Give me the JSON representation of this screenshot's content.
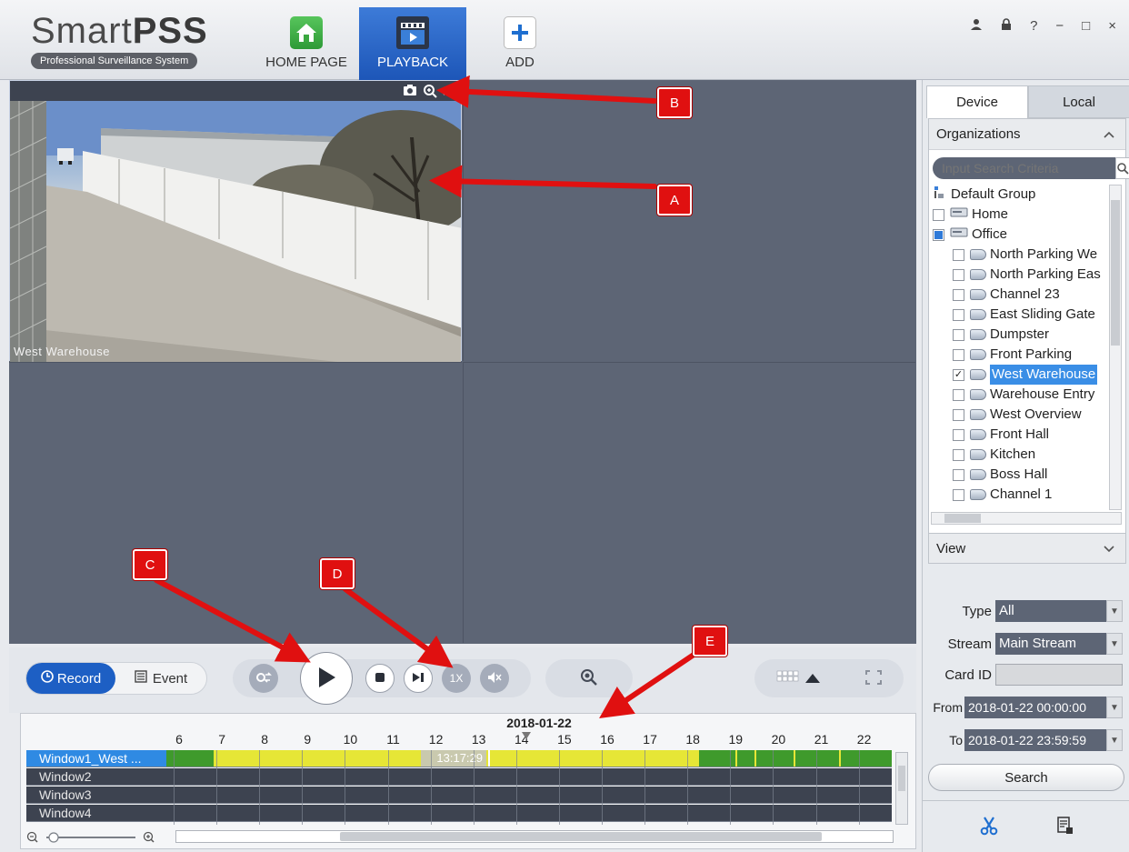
{
  "header": {
    "logo_main_plain": "Smart",
    "logo_main_bold": "PSS",
    "logo_sub": "Professional Surveillance System",
    "nav": [
      {
        "label": "HOME PAGE",
        "icon": "house-icon"
      },
      {
        "label": "PLAYBACK",
        "icon": "film-playback-icon",
        "active": true
      },
      {
        "label": "ADD",
        "icon": "plus-icon"
      }
    ],
    "window_controls": [
      "user-icon",
      "lock-icon",
      "help-icon",
      "minimize-icon",
      "maximize-icon",
      "close-icon"
    ],
    "help_glyph": "?",
    "minimize_glyph": "−",
    "maximize_glyph": "□",
    "close_glyph": "×"
  },
  "video": {
    "channel_label": "West Warehouse"
  },
  "callouts": [
    "A",
    "B",
    "C",
    "D",
    "E"
  ],
  "controls": {
    "record_label": "Record",
    "event_label": "Event",
    "speed_label": "1X"
  },
  "timeline": {
    "date": "2018-01-22",
    "hours": [
      "6",
      "7",
      "8",
      "9",
      "10",
      "11",
      "12",
      "13",
      "14",
      "15",
      "16",
      "17",
      "18",
      "19",
      "20",
      "21",
      "22"
    ],
    "current_time": "13:17:29",
    "windows": [
      "Window1_West ...",
      "Window2",
      "Window3",
      "Window4"
    ]
  },
  "panel": {
    "tab_device": "Device",
    "tab_local": "Local",
    "organizations_label": "Organizations",
    "search_placeholder": "Input Search Criteria",
    "tree": [
      {
        "label": "Default Group",
        "level": 0,
        "kind": "group"
      },
      {
        "label": "Home",
        "level": 0,
        "kind": "device",
        "check": "none"
      },
      {
        "label": "Office",
        "level": 0,
        "kind": "device",
        "check": "partial"
      },
      {
        "label": "North Parking We",
        "level": 1,
        "kind": "camera",
        "check": "none"
      },
      {
        "label": "North Parking Eas",
        "level": 1,
        "kind": "camera",
        "check": "none"
      },
      {
        "label": "Channel 23",
        "level": 1,
        "kind": "camera",
        "check": "none"
      },
      {
        "label": "East Sliding Gate",
        "level": 1,
        "kind": "camera",
        "check": "none"
      },
      {
        "label": "Dumpster",
        "level": 1,
        "kind": "camera",
        "check": "none"
      },
      {
        "label": "Front Parking",
        "level": 1,
        "kind": "camera",
        "check": "none"
      },
      {
        "label": "West Warehouse",
        "level": 1,
        "kind": "camera",
        "check": "checked",
        "selected": true
      },
      {
        "label": "Warehouse Entry",
        "level": 1,
        "kind": "camera",
        "check": "none"
      },
      {
        "label": "West Overview",
        "level": 1,
        "kind": "camera",
        "check": "none"
      },
      {
        "label": "Front Hall",
        "level": 1,
        "kind": "camera",
        "check": "none"
      },
      {
        "label": "Kitchen",
        "level": 1,
        "kind": "camera",
        "check": "none"
      },
      {
        "label": "Boss Hall",
        "level": 1,
        "kind": "camera",
        "check": "none"
      },
      {
        "label": "Channel 1",
        "level": 1,
        "kind": "camera",
        "check": "none"
      }
    ],
    "view_label": "View",
    "type_label": "Type",
    "type_value": "All",
    "stream_label": "Stream",
    "stream_value": "Main Stream",
    "cardid_label": "Card ID",
    "cardid_value": "",
    "from_label": "From",
    "from_value": "2018-01-22 00:00:00",
    "to_label": "To",
    "to_value": "2018-01-22 23:59:59",
    "search_label": "Search"
  },
  "colors": {
    "accent": "#1d5fc4",
    "record_green": "#3f9a2c",
    "record_yellow": "#e6e636",
    "callout_red": "#e01010",
    "grid_bg": "#5d6575"
  }
}
